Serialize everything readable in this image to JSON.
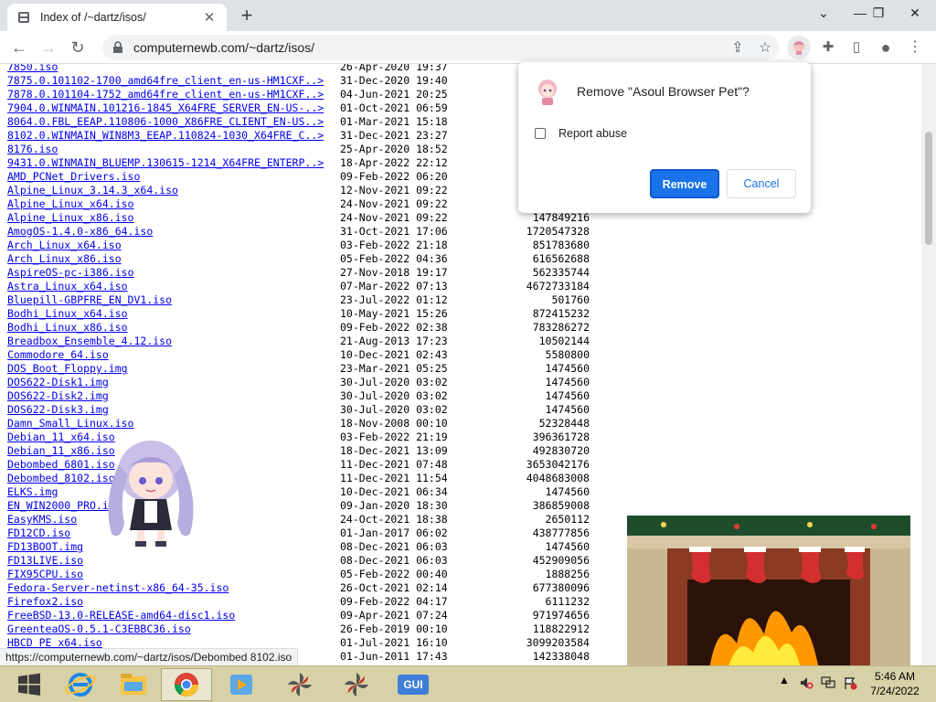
{
  "browser": {
    "tab_title": "Index of /~dartz/isos/",
    "tab_close": "✕",
    "new_tab": "+",
    "url": "computernewb.com/~dartz/isos/",
    "status_url": "https://computernewb.com/~dartz/isos/Debombed 8102.iso"
  },
  "window": {
    "chevron": "⌄",
    "minimize": "—",
    "restore": "❐",
    "close": "✕"
  },
  "toolbar": {
    "back": "←",
    "forward": "→",
    "reload": "↻",
    "share": "⇪",
    "bookmark": "☆",
    "extensions": "✚",
    "sidepanel": "▯",
    "profile": "●",
    "menu": "⋮"
  },
  "dialog": {
    "title": "Remove \"Asoul Browser Pet\"?",
    "report_label": "Report abuse",
    "report_checked": false,
    "remove_label": "Remove",
    "cancel_label": "Cancel"
  },
  "listing": [
    {
      "name": "7850.iso",
      "date": "26-Apr-2020 19:37",
      "size": ""
    },
    {
      "name": "7875.0.101102-1700_amd64fre_client_en-us-HM1CXF..>",
      "date": "31-Dec-2020 19:40",
      "size": ""
    },
    {
      "name": "7878.0.101104-1752_amd64fre_client_en-us-HM1CXF..>",
      "date": "04-Jun-2021 20:25",
      "size": ""
    },
    {
      "name": "7904.0.WINMAIN.101216-1845_X64FRE_SERVER_EN-US-..>",
      "date": "01-Oct-2021 06:59",
      "size": ""
    },
    {
      "name": "8064.0.FBL_EEAP.110806-1000_X86FRE_CLIENT_EN-US..>",
      "date": "01-Mar-2021 15:18",
      "size": ""
    },
    {
      "name": "8102.0.WINMAIN_WIN8M3_EEAP.110824-1030_X64FRE_C..>",
      "date": "31-Dec-2021 23:27",
      "size": ""
    },
    {
      "name": "8176.iso",
      "date": "25-Apr-2020 18:52",
      "size": ""
    },
    {
      "name": "9431.0.WINMAIN_BLUEMP.130615-1214_X64FRE_ENTERP..>",
      "date": "18-Apr-2022 22:12",
      "size": ""
    },
    {
      "name": "AMD_PCNet_Drivers.iso",
      "date": "09-Feb-2022 06:20",
      "size": ""
    },
    {
      "name": "Alpine_Linux_3.14.3_x64.iso",
      "date": "12-Nov-2021 09:22",
      "size": ""
    },
    {
      "name": "Alpine_Linux_x64.iso",
      "date": "24-Nov-2021 09:22",
      "size": ""
    },
    {
      "name": "Alpine_Linux_x86.iso",
      "date": "24-Nov-2021 09:22",
      "size": "147849216"
    },
    {
      "name": "AmogOS-1.4.0-x86_64.iso",
      "date": "31-Oct-2021 17:06",
      "size": "1720547328"
    },
    {
      "name": "Arch_Linux_x64.iso",
      "date": "03-Feb-2022 21:18",
      "size": "851783680"
    },
    {
      "name": "Arch_Linux_x86.iso",
      "date": "05-Feb-2022 04:36",
      "size": "616562688"
    },
    {
      "name": "AspireOS-pc-i386.iso",
      "date": "27-Nov-2018 19:17",
      "size": "562335744"
    },
    {
      "name": "Astra_Linux_x64.iso",
      "date": "07-Mar-2022 07:13",
      "size": "4672733184"
    },
    {
      "name": "Bluepill-GBPFRE_EN_DV1.iso",
      "date": "23-Jul-2022 01:12",
      "size": "501760"
    },
    {
      "name": "Bodhi_Linux_x64.iso",
      "date": "10-May-2021 15:26",
      "size": "872415232"
    },
    {
      "name": "Bodhi_Linux_x86.iso",
      "date": "09-Feb-2022 02:38",
      "size": "783286272"
    },
    {
      "name": "Breadbox_Ensemble_4.12.iso",
      "date": "21-Aug-2013 17:23",
      "size": "10502144"
    },
    {
      "name": "Commodore_64.iso",
      "date": "10-Dec-2021 02:43",
      "size": "5580800"
    },
    {
      "name": "DOS_Boot_Floppy.img",
      "date": "23-Mar-2021 05:25",
      "size": "1474560"
    },
    {
      "name": "DOS622-Disk1.img",
      "date": "30-Jul-2020 03:02",
      "size": "1474560"
    },
    {
      "name": "DOS622-Disk2.img",
      "date": "30-Jul-2020 03:02",
      "size": "1474560"
    },
    {
      "name": "DOS622-Disk3.img",
      "date": "30-Jul-2020 03:02",
      "size": "1474560"
    },
    {
      "name": "Damn_Small_Linux.iso",
      "date": "18-Nov-2008 00:10",
      "size": "52328448"
    },
    {
      "name": "Debian_11_x64.iso",
      "date": "03-Feb-2022 21:19",
      "size": "396361728"
    },
    {
      "name": "Debian_11_x86.iso",
      "date": "18-Dec-2021 13:09",
      "size": "492830720"
    },
    {
      "name": "Debombed_6801.iso",
      "date": "11-Dec-2021 07:48",
      "size": "3653042176"
    },
    {
      "name": "Debombed_8102.iso",
      "date": "11-Dec-2021 11:54",
      "size": "4048683008"
    },
    {
      "name": "ELKS.img",
      "date": "10-Dec-2021 06:34",
      "size": "1474560"
    },
    {
      "name": "EN_WIN2000_PRO.iso",
      "date": "09-Jan-2020 18:30",
      "size": "386859008"
    },
    {
      "name": "EasyKMS.iso",
      "date": "24-Oct-2021 18:38",
      "size": "2650112"
    },
    {
      "name": "FD12CD.iso",
      "date": "01-Jan-2017 06:02",
      "size": "438777856"
    },
    {
      "name": "FD13BOOT.img",
      "date": "08-Dec-2021 06:03",
      "size": "1474560"
    },
    {
      "name": "FD13LIVE.iso",
      "date": "08-Dec-2021 06:03",
      "size": "452909056"
    },
    {
      "name": "FIX95CPU.iso",
      "date": "05-Feb-2022 00:40",
      "size": "1888256"
    },
    {
      "name": "Fedora-Server-netinst-x86_64-35.iso",
      "date": "26-Oct-2021 02:14",
      "size": "677380096"
    },
    {
      "name": "Firefox2.iso",
      "date": "09-Feb-2022 04:17",
      "size": "6111232"
    },
    {
      "name": "FreeBSD-13.0-RELEASE-amd64-disc1.iso",
      "date": "09-Apr-2021 07:24",
      "size": "971974656"
    },
    {
      "name": "GreenteaOS-0.5.1-C3EBBC36.iso",
      "date": "26-Feb-2019 00:10",
      "size": "118822912"
    },
    {
      "name": "HBCD_PE_x64.iso",
      "date": "01-Jul-2021 16:10",
      "size": "3099203584"
    },
    {
      "name": "",
      "date": "01-Jun-2011 17:43",
      "size": "142338048"
    }
  ],
  "taskbar": {
    "apps": [
      "start",
      "internet-explorer",
      "file-explorer",
      "chrome",
      "media-player",
      "pinwheel-app",
      "pinwheel-app-2",
      "gui-app"
    ],
    "gui_label": "GUI",
    "time": "5:46 AM",
    "date": "7/24/2022"
  },
  "colors": {
    "link": "#0000ee",
    "accent": "#1a73e8",
    "taskbar": "#d8d0a6"
  }
}
